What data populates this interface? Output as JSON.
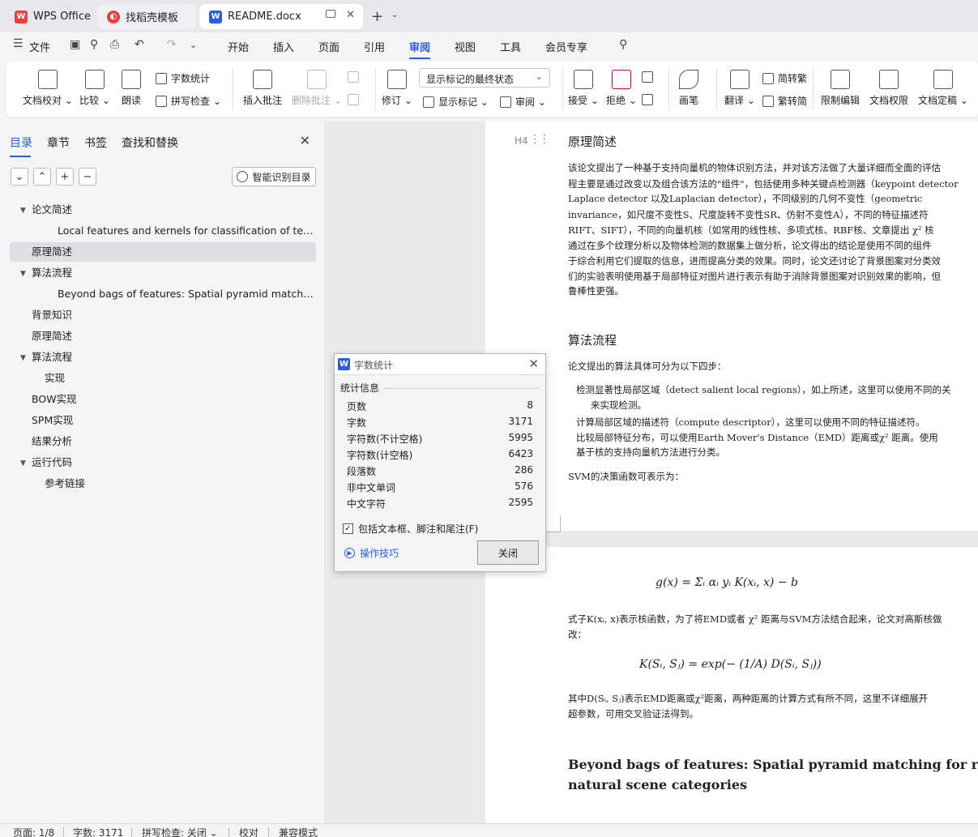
{
  "tabs": [
    {
      "label": "WPS Office"
    },
    {
      "label": "找稻壳模板"
    },
    {
      "label": "README.docx"
    }
  ],
  "menu": {
    "file": "文件",
    "items": [
      "开始",
      "插入",
      "页面",
      "引用",
      "审阅",
      "视图",
      "工具",
      "会员专享"
    ],
    "active": "审阅"
  },
  "ribbon": {
    "doc_proof": "文档校对",
    "compare": "比较",
    "read_aloud": "朗读",
    "word_count": "字数统计",
    "spell_check": "拼写检查",
    "insert_comment": "插入批注",
    "delete_comment": "删除批注",
    "track_changes": "修订",
    "markup_dropdown": "显示标记的最终状态",
    "show_markup": "显示标记",
    "review_pane": "审阅",
    "accept": "接受",
    "reject": "拒绝",
    "pen": "画笔",
    "translate": "翻译",
    "to_traditional": "简转繁",
    "to_simplified": "繁转简",
    "restrict_edit": "限制编辑",
    "doc_permission": "文档权限",
    "doc_finalize": "文档定稿"
  },
  "nav": {
    "tabs": [
      "目录",
      "章节",
      "书签",
      "查找和替换"
    ],
    "smart_toc": "智能识别目录",
    "toc": [
      {
        "label": "论文简述",
        "level": 1,
        "expanded": true
      },
      {
        "label": "Local features and kernels for classification of texture and object categories: A comprehensive study",
        "level": 3
      },
      {
        "label": "原理简述",
        "level": 1,
        "selected": true
      },
      {
        "label": "算法流程",
        "level": 1,
        "expanded": true
      },
      {
        "label": "Beyond bags of features: Spatial pyramid matching for recognizing natural scene categories",
        "level": 3
      },
      {
        "label": "背景知识",
        "level": 1
      },
      {
        "label": "原理简述",
        "level": 1
      },
      {
        "label": "算法流程",
        "level": 1,
        "expanded": true
      },
      {
        "label": "实现",
        "level": 2
      },
      {
        "label": "BOW实现",
        "level": 1
      },
      {
        "label": "SPM实现",
        "level": 1
      },
      {
        "label": "结果分析",
        "level": 1
      },
      {
        "label": "运行代码",
        "level": 1,
        "expanded": true
      },
      {
        "label": "参考链接",
        "level": 2
      }
    ]
  },
  "doc": {
    "heading_marker": "H4",
    "h_principle": "原理简述",
    "p1": [
      "该论文提出了一种基于支持向量机的物体识别方法，并对该方法做了大量详细而全面的评估",
      "程主要是通过改变以及组合该方法的\"组件\"，包括使用多种关键点检测器（keypoint detector",
      "Laplace detector 以及Laplacian detector），不同级别的几何不变性（geometric",
      "invariance，如尺度不变性S、尺度旋转不变性SR、仿射不变性A），不同的特征描述符",
      "RIFT、SIFT），不同的向量机核（如常用的线性核、多项式核、RBF核、文章提出 χ² 核",
      "通过在多个纹理分析以及物体检测的数据集上做分析，论文得出的结论是使用不同的组件",
      "于综合利用它们提取的信息，进而提高分类的效果。同时，论文还讨论了背景图案对分类效",
      "们的实验表明使用基于局部特征对图片进行表示有助于消除背景图案对识别效果的影响，但",
      "鲁棒性更强。"
    ],
    "h_algorithm": "算法流程",
    "p2": "论文提出的算法具体可分为以下四步：",
    "steps": [
      "检测显著性局部区域（detect salient local regions），如上所述，这里可以使用不同的关",
      "来实现检测。",
      "计算局部区域的描述符（compute descriptor），这里可以使用不同的特征描述符。",
      "比较局部特征分布，可以使用Earth Mover's Distance（EMD）距离或χ² 距离。使用",
      "基于核的支持向量机方法进行分类。"
    ],
    "p3": "SVM的决策函数可表示为：",
    "formula1": "g(x) = Σᵢ αᵢ yᵢ K(xᵢ, x) − b",
    "p4": [
      "式子K(xᵢ, x)表示核函数，为了将EMD或者 χ² 距离与SVM方法结合起来，论文对高斯核做",
      "改："
    ],
    "formula2": "K(Sᵢ, Sⱼ) = exp(− (1/A) D(Sᵢ, Sⱼ))",
    "p5": [
      "其中D(Sᵢ, Sⱼ)表示EMD距离或χ²距离，两种距离的计算方式有所不同，这里不详细展开",
      "超参数，可用交叉验证法得到。"
    ],
    "bold_title": [
      "Beyond bags of features: Spatial pyramid matching for recogn",
      "natural scene categories"
    ]
  },
  "dialog": {
    "title": "字数统计",
    "section": "统计信息",
    "rows": [
      {
        "label": "页数",
        "value": "8"
      },
      {
        "label": "字数",
        "value": "3171"
      },
      {
        "label": "字符数(不计空格)",
        "value": "5995"
      },
      {
        "label": "字符数(计空格)",
        "value": "6423"
      },
      {
        "label": "段落数",
        "value": "286"
      },
      {
        "label": "非中文单词",
        "value": "576"
      },
      {
        "label": "中文字符",
        "value": "2595"
      }
    ],
    "checkbox_label": "包括文本框、脚注和尾注(F)",
    "tips": "操作技巧",
    "close": "关闭"
  },
  "status": {
    "page": "页面: 1/8",
    "words": "字数: 3171",
    "spell": "拼写检查: 关闭",
    "proof": "校对",
    "compat": "兼容模式"
  },
  "colors": {
    "accent": "#2b5fd9",
    "wps_red": "#e8403c"
  }
}
